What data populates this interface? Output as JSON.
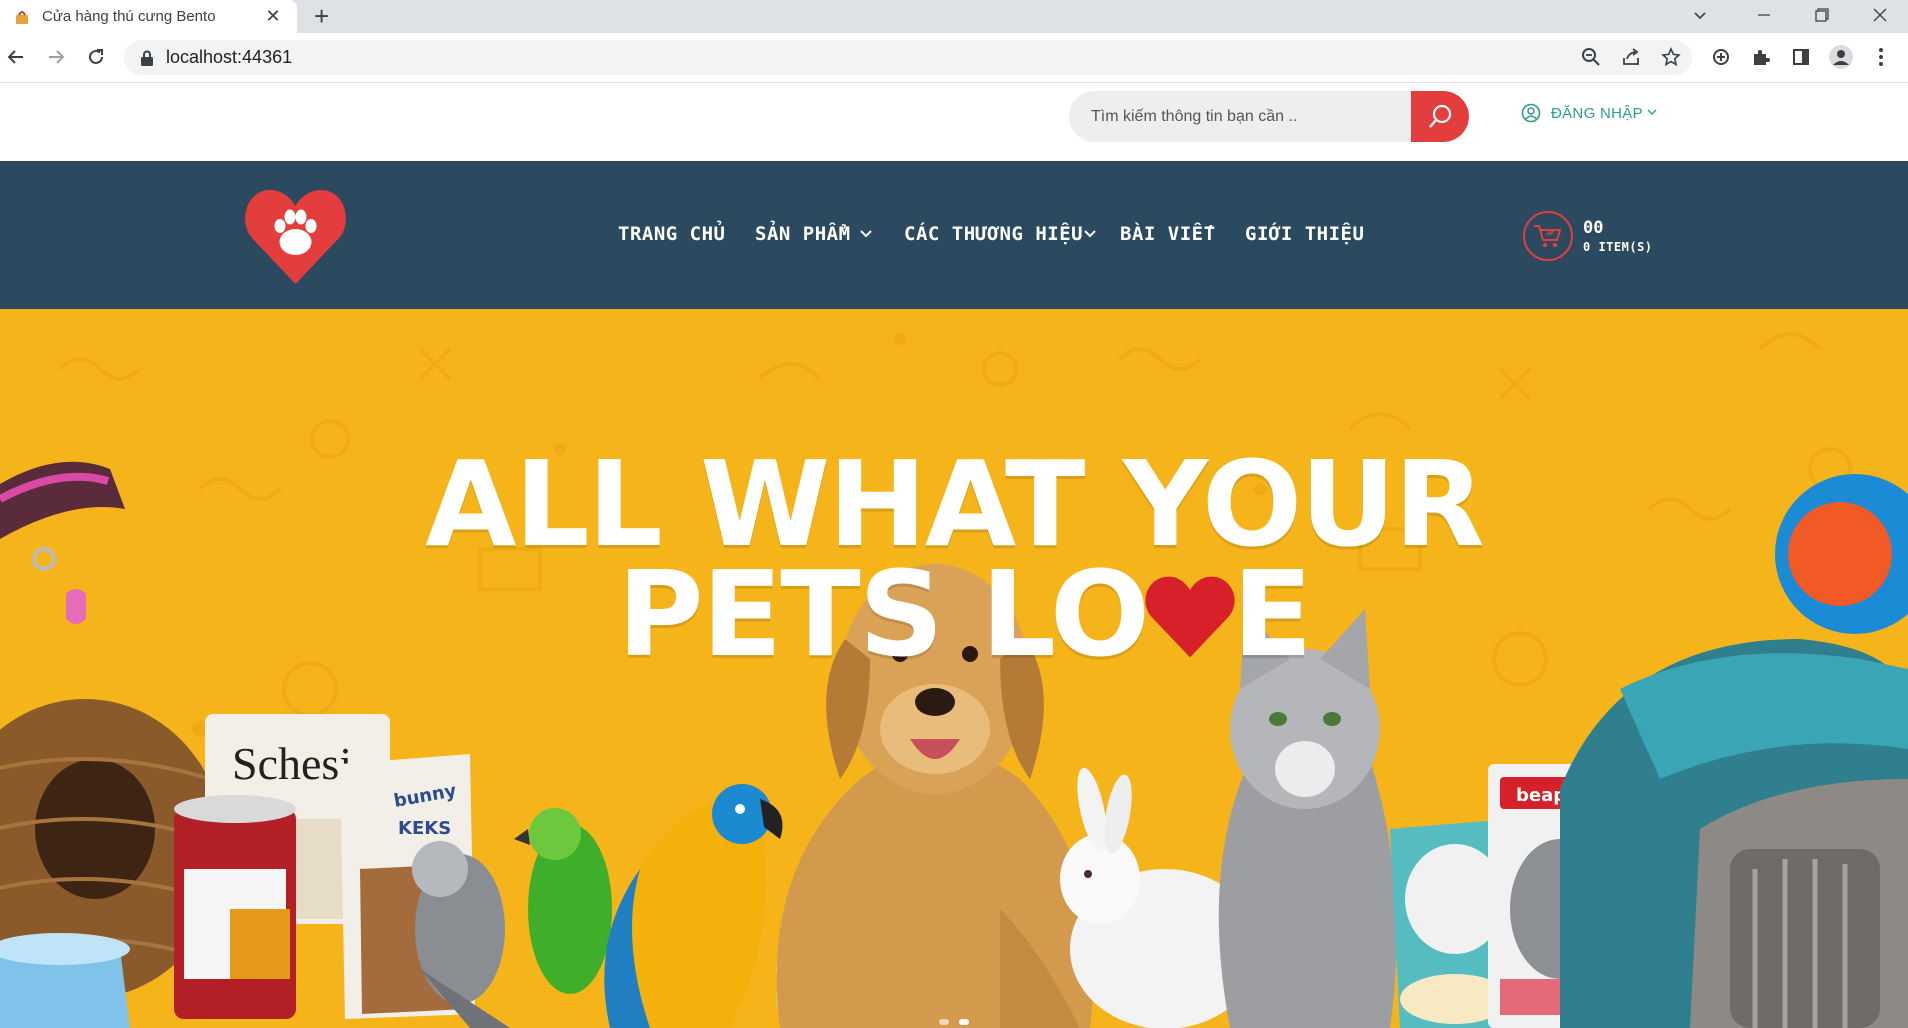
{
  "browser": {
    "tab_title": "Cửa hàng thú cưng Bento",
    "new_tab": "+",
    "url": "localhost:44361"
  },
  "site": {
    "search": {
      "placeholder": "Tìm kiếm thông tin bạn cần .."
    },
    "login": {
      "label": "ĐĂNG NHẬP"
    },
    "nav": [
      {
        "label": "TRANG CHỦ"
      },
      {
        "label": "SẢN PHẨM"
      },
      {
        "label": "CÁC THƯƠNG HIỆU"
      },
      {
        "label": "BÀI VIẾT"
      },
      {
        "label": "GIỚI THIỆU"
      }
    ],
    "cart": {
      "total": "00",
      "items": "0 ITEM(S)"
    }
  },
  "hero": {
    "headline_line1": "ALL WHAT YOUR",
    "headline_line2_a": "PETS LO",
    "headline_line2_b": "E",
    "slide_count": 2,
    "active_slide": 2
  },
  "colors": {
    "nav_bg": "#2c4a5f",
    "accent_red": "#e43d3d",
    "hero_yellow": "#f6b41b",
    "login_teal": "#2b9d8f"
  },
  "icons": [
    "favicon-icon",
    "close-icon",
    "back-icon",
    "forward-icon",
    "reload-icon",
    "lock-icon",
    "zoom-icon",
    "share-icon",
    "star-icon",
    "extension-icon",
    "puzzle-icon",
    "sidepanel-icon",
    "profile-icon",
    "menu-icon",
    "search-icon",
    "user-icon",
    "paw-heart-logo",
    "cart-icon",
    "heart-icon"
  ]
}
